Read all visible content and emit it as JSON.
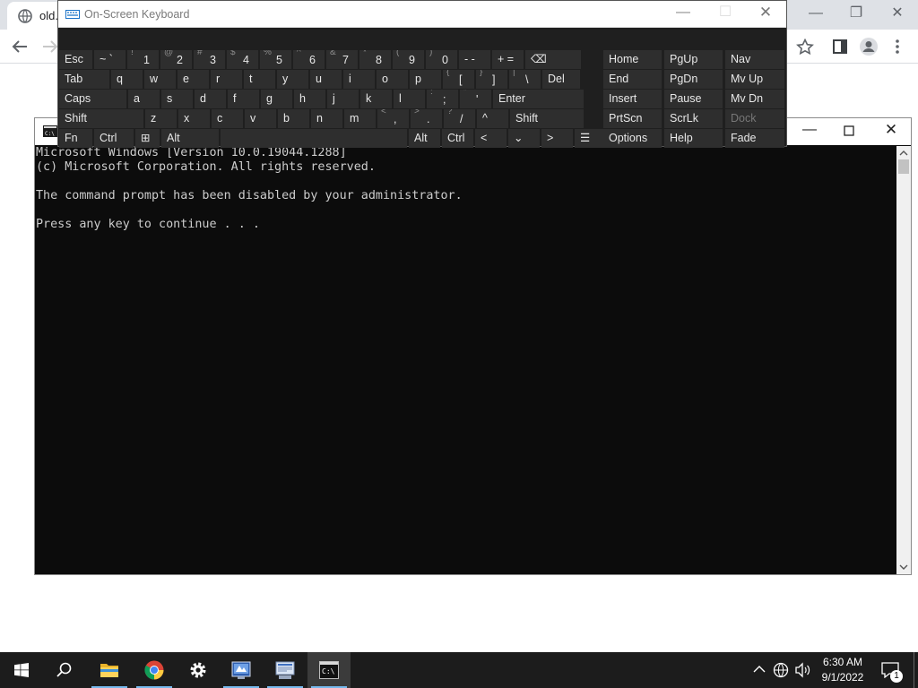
{
  "browser": {
    "tab_title": "old.",
    "back_icon": "arrow-left-icon",
    "forward_icon": "arrow-right-icon"
  },
  "osk": {
    "title": "On-Screen Keyboard",
    "rows": [
      [
        {
          "label": "Esc"
        },
        {
          "label": "~ `"
        },
        {
          "sub": "!",
          "label": "1"
        },
        {
          "sub": "@",
          "label": "2"
        },
        {
          "sub": "#",
          "label": "3"
        },
        {
          "sub": "$",
          "label": "4"
        },
        {
          "sub": "%",
          "label": "5"
        },
        {
          "sub": "^",
          "label": "6"
        },
        {
          "sub": "&",
          "label": "7"
        },
        {
          "sub": "*",
          "label": "8"
        },
        {
          "sub": "(",
          "label": "9"
        },
        {
          "sub": ")",
          "label": "0"
        },
        {
          "label": "- -"
        },
        {
          "label": "+ ="
        },
        {
          "label": "⌫"
        }
      ],
      [
        {
          "label": "Tab"
        },
        {
          "label": "q"
        },
        {
          "label": "w"
        },
        {
          "label": "e"
        },
        {
          "label": "r"
        },
        {
          "label": "t"
        },
        {
          "label": "y"
        },
        {
          "label": "u"
        },
        {
          "label": "i"
        },
        {
          "label": "o"
        },
        {
          "label": "p"
        },
        {
          "sub": "{",
          "label": "["
        },
        {
          "sub": "}",
          "label": "]"
        },
        {
          "sub": "|",
          "label": "\\"
        },
        {
          "label": "Del"
        }
      ],
      [
        {
          "label": "Caps"
        },
        {
          "label": "a"
        },
        {
          "label": "s"
        },
        {
          "label": "d"
        },
        {
          "label": "f"
        },
        {
          "label": "g"
        },
        {
          "label": "h"
        },
        {
          "label": "j"
        },
        {
          "label": "k"
        },
        {
          "label": "l"
        },
        {
          "sub": ":",
          "label": ";"
        },
        {
          "sub": "\"",
          "label": "'"
        },
        {
          "label": "Enter"
        }
      ],
      [
        {
          "label": "Shift"
        },
        {
          "label": "z"
        },
        {
          "label": "x"
        },
        {
          "label": "c"
        },
        {
          "label": "v"
        },
        {
          "label": "b"
        },
        {
          "label": "n"
        },
        {
          "label": "m"
        },
        {
          "sub": "<",
          "label": ","
        },
        {
          "sub": ">",
          "label": "."
        },
        {
          "sub": "?",
          "label": "/"
        },
        {
          "label": "^"
        },
        {
          "label": "Shift"
        }
      ],
      [
        {
          "label": "Fn"
        },
        {
          "label": "Ctrl"
        },
        {
          "label": "⊞"
        },
        {
          "label": "Alt"
        },
        {
          "label": ""
        },
        {
          "label": "Alt"
        },
        {
          "label": "Ctrl"
        },
        {
          "label": "<"
        },
        {
          "label": "⌄"
        },
        {
          "label": ">"
        },
        {
          "label": "☰"
        }
      ]
    ],
    "nav_keys": [
      [
        "Home",
        "PgUp",
        "Nav"
      ],
      [
        "End",
        "PgDn",
        "Mv Up"
      ],
      [
        "Insert",
        "Pause",
        "Mv Dn"
      ],
      [
        "PrtScn",
        "ScrLk",
        "Dock"
      ],
      [
        "Options",
        "Help",
        "Fade"
      ]
    ]
  },
  "cmd": {
    "lines": [
      "Microsoft Windows [Version 10.0.19044.1288]",
      "(c) Microsoft Corporation. All rights reserved.",
      "",
      "The command prompt has been disabled by your administrator.",
      "",
      "Press any key to continue . . ."
    ]
  },
  "taskbar": {
    "items": [
      "windows-start-icon",
      "search-icon",
      "file-explorer-icon",
      "chrome-icon",
      "settings-icon",
      "app-icon-1",
      "app-icon-2",
      "cmd-icon"
    ],
    "time": "6:30 AM",
    "date": "9/1/2022",
    "notification_count": "1"
  }
}
